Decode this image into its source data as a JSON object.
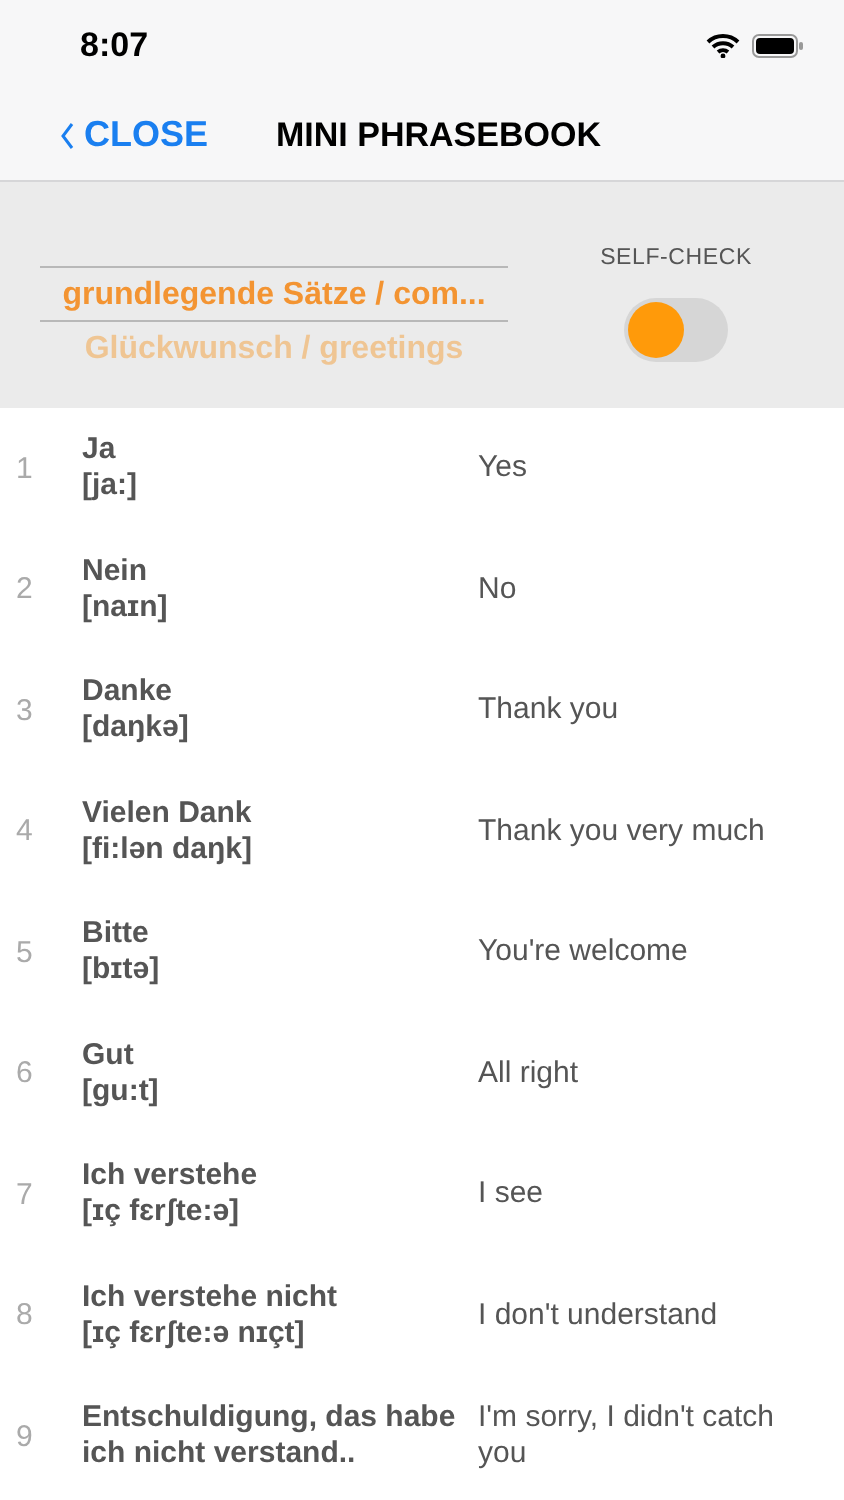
{
  "status_bar": {
    "time": "8:07"
  },
  "nav": {
    "back": "CLOSE",
    "title": "MINI PHRASEBOOK"
  },
  "picker": {
    "items": [
      {
        "label": "grundlegende Sätze / com...",
        "selected": true
      },
      {
        "label": "Glückwunsch / greetings",
        "selected": false
      }
    ]
  },
  "self_check": {
    "label": "SELF-CHECK",
    "on": false
  },
  "phrases": [
    {
      "number": "1",
      "german": "Ja",
      "ipa": "[ja:]",
      "english": "Yes"
    },
    {
      "number": "2",
      "german": "Nein",
      "ipa": "[naɪn]",
      "english": "No"
    },
    {
      "number": "3",
      "german": "Danke",
      "ipa": "[daŋkə]",
      "english": "Thank you"
    },
    {
      "number": "4",
      "german": "Vielen Dank",
      "ipa": "[fi:lən daŋk]",
      "english": "Thank you very much"
    },
    {
      "number": "5",
      "german": "Bitte",
      "ipa": "[bɪtə]",
      "english": "You're welcome"
    },
    {
      "number": "6",
      "german": "Gut",
      "ipa": "[gu:t]",
      "english": "All right"
    },
    {
      "number": "7",
      "german": "Ich verstehe",
      "ipa": "[ɪç fɛrʃte:ə]",
      "english": "I see"
    },
    {
      "number": "8",
      "german": "Ich verstehe nicht",
      "ipa": "[ɪç fɛrʃte:ə nɪçt]",
      "english": "I don't understand"
    },
    {
      "number": "9",
      "german": "Entschuldigung, das habe ich nicht verstand..",
      "english": "I'm sorry, I didn't catch you"
    }
  ]
}
